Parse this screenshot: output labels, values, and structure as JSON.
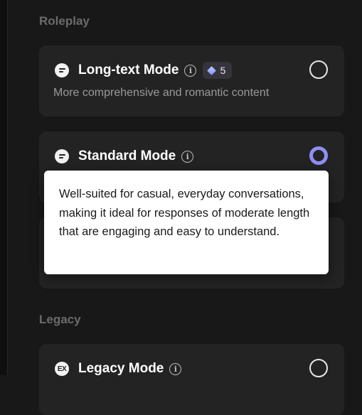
{
  "sections": {
    "roleplay": "Roleplay",
    "legacy": "Legacy"
  },
  "modes": {
    "long_text": {
      "title": "Long-text Mode",
      "cost": "5",
      "description": "More comprehensive and romantic content",
      "selected": false
    },
    "standard": {
      "title": "Standard Mode",
      "selected": true
    },
    "legacy": {
      "title": "Legacy Mode",
      "selected": false
    }
  },
  "tooltip": {
    "text": "Well-suited for casual, everyday conversations, making it ideal for responses of moderate length that are engaging and easy to understand."
  },
  "icons": {
    "mode": "chat-bubble-icon",
    "legacy": "ex-badge-icon",
    "info": "info-icon",
    "gem": "gem-icon"
  },
  "colors": {
    "accent": "#8f8ff5",
    "background": "#181818",
    "card": "#232323"
  }
}
